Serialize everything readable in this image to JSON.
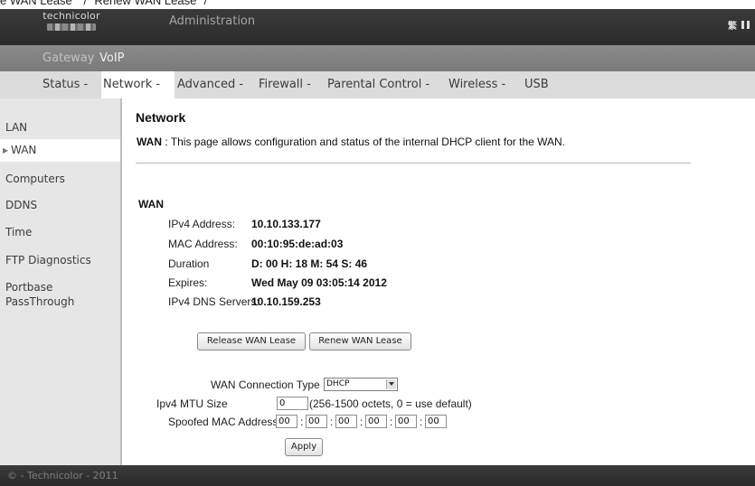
{
  "top_clip_text": "e WAN Lease\" \"/ \"Renew WAN Lease\" /",
  "header": {
    "logo_text": "technicolor",
    "title": "Administration",
    "icons": [
      "language-icon",
      "window-icon"
    ]
  },
  "top_tabs": [
    "Gateway",
    "VoIP"
  ],
  "nav": {
    "items": [
      "Status -",
      "Network -",
      "Advanced -",
      "Firewall -",
      "Parental Control -",
      "Wireless -",
      "USB"
    ],
    "active": "Network -"
  },
  "sidebar": {
    "items": [
      "LAN",
      "WAN",
      "Computers",
      "DDNS",
      "Time",
      "FTP Diagnostics",
      "Portbase",
      "PassThrough"
    ],
    "active": "WAN"
  },
  "page": {
    "title": "Network",
    "desc_label": "WAN",
    "desc_text": " : This page allows configuration and status of the internal DHCP client for the WAN."
  },
  "wan": {
    "title": "WAN",
    "rows": [
      {
        "label": "IPv4 Address:",
        "value": "10.10.133.177"
      },
      {
        "label": "MAC Address:",
        "value": "00:10:95:de:ad:03"
      },
      {
        "label": "Duration",
        "value": "D: 00 H: 18 M: 54 S: 46"
      },
      {
        "label": "Expires:",
        "value": "Wed May 09 03:05:14 2012"
      },
      {
        "label": "IPv4 DNS Servers:",
        "value": "10.10.159.253"
      }
    ]
  },
  "buttons": {
    "release": "Release WAN Lease",
    "renew": "Renew WAN Lease",
    "apply": "Apply"
  },
  "form": {
    "conn_type_label": "WAN Connection Type",
    "conn_type_value": "DHCP",
    "mtu_label": "Ipv4 MTU Size",
    "mtu_value": "0",
    "mtu_hint": "(256-1500 octets, 0 = use default)",
    "mac_label": "Spoofed MAC Address",
    "mac_values": [
      "00",
      "00",
      "00",
      "00",
      "00",
      "00"
    ],
    "mac_separator": ":"
  },
  "footer": {
    "text": "© - Technicolor - 2011"
  }
}
